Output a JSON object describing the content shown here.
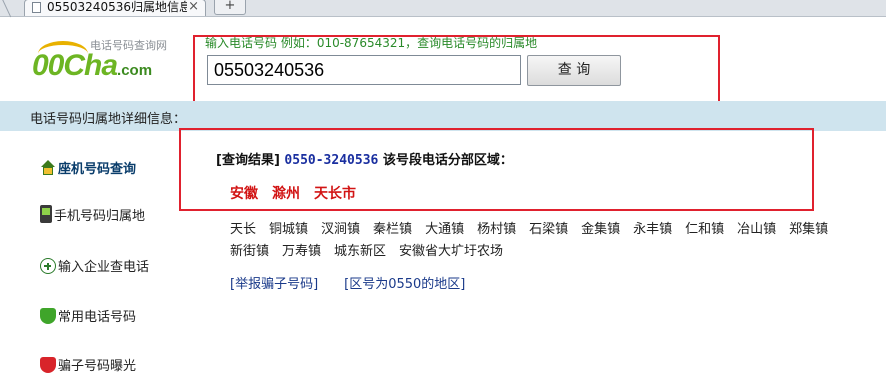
{
  "browser": {
    "tab_title": "05503240536归属地信息",
    "tab_close": "×",
    "new_tab": "+"
  },
  "logo": {
    "subtitle": "电话号码查询网",
    "name": "00Cha",
    "domain": ".com"
  },
  "search": {
    "hint": "输入电话号码  例如：010-87654321，查询电话号码的归属地",
    "value": "05503240536",
    "button_label": "查 询"
  },
  "section_title": "电话号码归属地详细信息：",
  "sidebar": {
    "items": [
      {
        "label": "座机号码查询",
        "icon": "home-icon",
        "active": true
      },
      {
        "label": "手机号码归属地",
        "icon": "mobile-phone-icon"
      },
      {
        "label": "输入企业查电话",
        "icon": "plus-circle-icon"
      },
      {
        "label": "常用电话号码",
        "icon": "green-shield-icon"
      },
      {
        "label": "骗子号码曝光",
        "icon": "red-shield-icon"
      }
    ]
  },
  "result": {
    "prefix": "[查询结果]",
    "number": "0550-3240536",
    "suffix": "该号段电话分部区域：",
    "region": [
      "安徽",
      "滁州",
      "天长市"
    ]
  },
  "towns": [
    "天长",
    "铜城镇",
    "汊涧镇",
    "秦栏镇",
    "大通镇",
    "杨村镇",
    "石梁镇",
    "金集镇",
    "永丰镇",
    "仁和镇",
    "冶山镇",
    "郑集镇",
    "新街镇",
    "万寿镇",
    "城东新区",
    "安徽省大圹圩农场"
  ],
  "links": [
    "[举报骗子号码]",
    "[区号为0550的地区]"
  ],
  "colors": {
    "accent_red": "#e0212e",
    "section_bg": "#cfe4ee",
    "region_red": "#d21414",
    "number_blue": "#1a2fa0"
  }
}
